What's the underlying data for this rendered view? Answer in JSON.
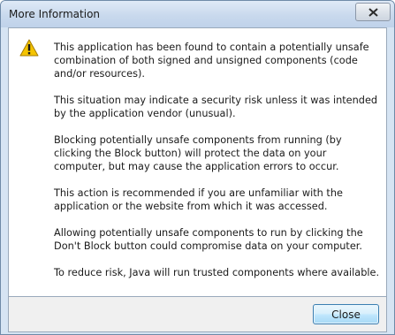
{
  "window": {
    "title": "More Information"
  },
  "message": {
    "icon": "warning-icon",
    "paragraphs": [
      "This application has been found to contain a potentially unsafe combination of both signed and unsigned components (code and/or resources).",
      "This situation may indicate a security risk unless it was intended by the application vendor (unusual).",
      "Blocking potentially unsafe components from running (by clicking the Block button) will protect the data on your computer, but may cause the application errors to occur.",
      "This action is recommended if you are unfamiliar with the application or the website from which it was accessed.",
      "Allowing potentially unsafe components to run by clicking the Don't Block button could compromise data on your computer.",
      "To reduce risk, Java will run trusted components where available."
    ]
  },
  "footer": {
    "close_label": "Close"
  },
  "colors": {
    "warning_yellow": "#f5c400",
    "titlebar": "#c9d9ed",
    "button_border": "#3c7fb1"
  }
}
